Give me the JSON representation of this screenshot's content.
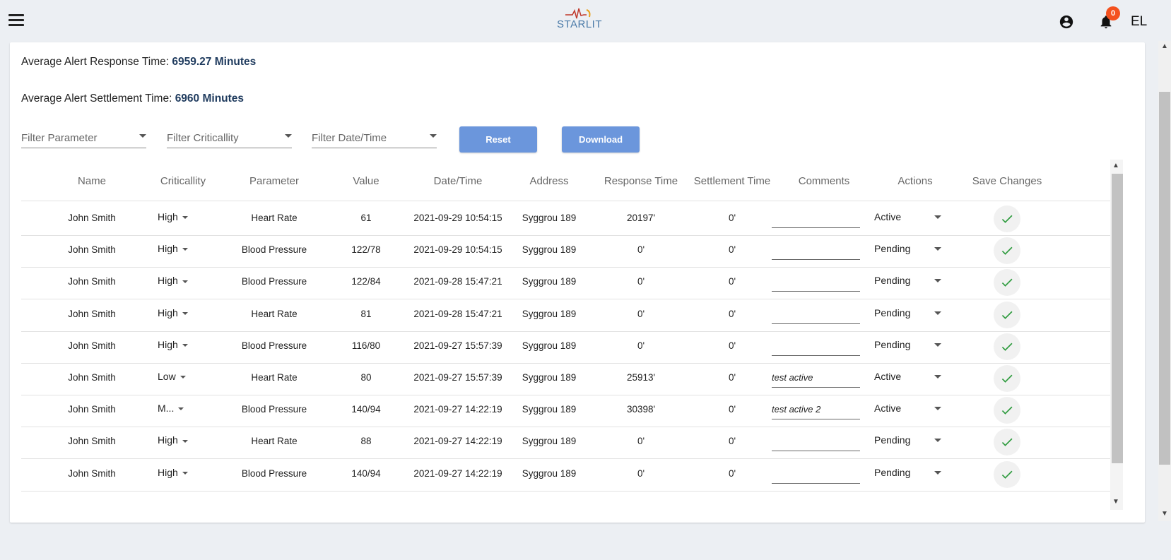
{
  "header": {
    "logo_text": "STARLIT",
    "notification_count": "0",
    "language": "EL"
  },
  "stats": {
    "response_label": "Average Alert Response Time: ",
    "response_value": "6959.27 Minutes",
    "settlement_label": "Average Alert Settlement Time: ",
    "settlement_value": "6960 Minutes"
  },
  "filters": {
    "parameter": "Filter Parameter",
    "criticality": "Filter Criticallity",
    "datetime": "Filter Date/Time"
  },
  "buttons": {
    "reset": "Reset",
    "download": "Download"
  },
  "table": {
    "headers": [
      "Name",
      "Criticallity",
      "Parameter",
      "Value",
      "Date/Time",
      "Address",
      "Response Time",
      "Settlement Time",
      "Comments",
      "Actions",
      "Save Changes"
    ],
    "rows": [
      {
        "name": "John Smith",
        "criticality": "High",
        "parameter": "Heart Rate",
        "value": "61",
        "datetime": "2021-09-29 10:54:15",
        "address": "Syggrou 189",
        "response": "20197'",
        "settlement": "0'",
        "comment": "",
        "action": "Active"
      },
      {
        "name": "John Smith",
        "criticality": "High",
        "parameter": "Blood Pressure",
        "value": "122/78",
        "datetime": "2021-09-29 10:54:15",
        "address": "Syggrou 189",
        "response": "0'",
        "settlement": "0'",
        "comment": "",
        "action": "Pending"
      },
      {
        "name": "John Smith",
        "criticality": "High",
        "parameter": "Blood Pressure",
        "value": "122/84",
        "datetime": "2021-09-28 15:47:21",
        "address": "Syggrou 189",
        "response": "0'",
        "settlement": "0'",
        "comment": "",
        "action": "Pending"
      },
      {
        "name": "John Smith",
        "criticality": "High",
        "parameter": "Heart Rate",
        "value": "81",
        "datetime": "2021-09-28 15:47:21",
        "address": "Syggrou 189",
        "response": "0'",
        "settlement": "0'",
        "comment": "",
        "action": "Pending"
      },
      {
        "name": "John Smith",
        "criticality": "High",
        "parameter": "Blood Pressure",
        "value": "116/80",
        "datetime": "2021-09-27 15:57:39",
        "address": "Syggrou 189",
        "response": "0'",
        "settlement": "0'",
        "comment": "",
        "action": "Pending"
      },
      {
        "name": "John Smith",
        "criticality": "Low",
        "parameter": "Heart Rate",
        "value": "80",
        "datetime": "2021-09-27 15:57:39",
        "address": "Syggrou 189",
        "response": "25913'",
        "settlement": "0'",
        "comment": "test active",
        "action": "Active"
      },
      {
        "name": "John Smith",
        "criticality": "M...",
        "parameter": "Blood Pressure",
        "value": "140/94",
        "datetime": "2021-09-27 14:22:19",
        "address": "Syggrou 189",
        "response": "30398'",
        "settlement": "0'",
        "comment": "test active 2",
        "action": "Active"
      },
      {
        "name": "John Smith",
        "criticality": "High",
        "parameter": "Heart Rate",
        "value": "88",
        "datetime": "2021-09-27 14:22:19",
        "address": "Syggrou 189",
        "response": "0'",
        "settlement": "0'",
        "comment": "",
        "action": "Pending"
      },
      {
        "name": "John Smith",
        "criticality": "High",
        "parameter": "Blood Pressure",
        "value": "140/94",
        "datetime": "2021-09-27 14:22:19",
        "address": "Syggrou 189",
        "response": "0'",
        "settlement": "0'",
        "comment": "",
        "action": "Pending"
      }
    ]
  },
  "colors": {
    "accent": "#6b96dc",
    "stat_value": "#1f3b5e",
    "badge": "#f4511e",
    "check": "#2e9b3e"
  },
  "icons": {
    "menu": "menu-icon",
    "account": "account-circle-icon",
    "notifications": "bell-icon",
    "save": "check-icon"
  }
}
